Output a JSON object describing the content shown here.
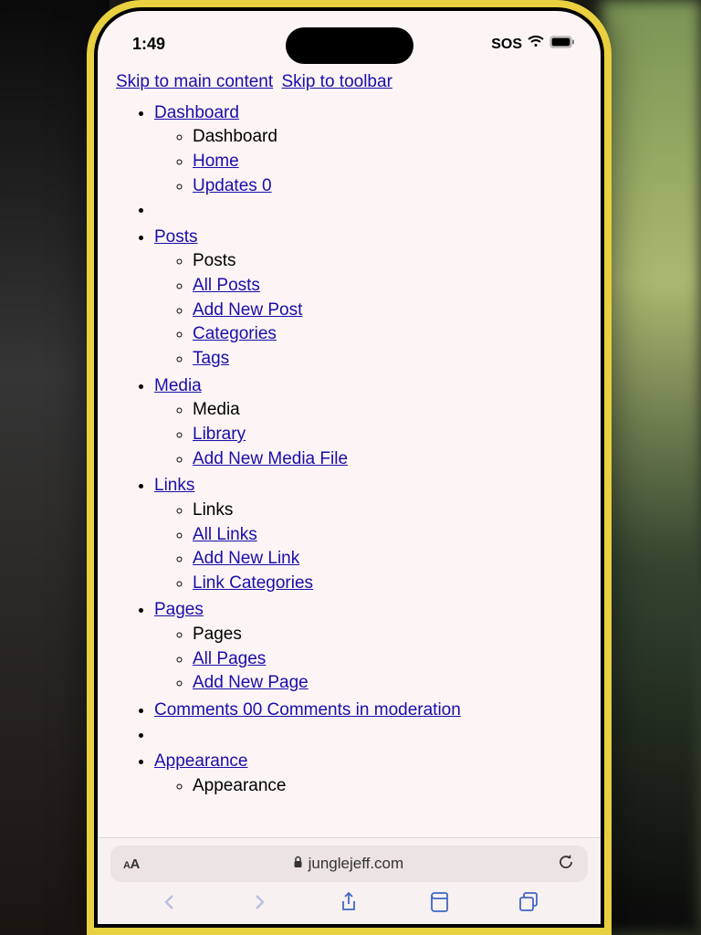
{
  "status": {
    "time": "1:49",
    "sos": "SOS"
  },
  "skip": {
    "main": "Skip to main content",
    "toolbar": "Skip to toolbar"
  },
  "menu": {
    "dashboard": {
      "heading": "Dashboard",
      "items": {
        "dashboard": "Dashboard",
        "home": "Home",
        "updates": "Updates 0"
      }
    },
    "posts": {
      "heading": "Posts",
      "items": {
        "posts": "Posts",
        "all": "All Posts",
        "add": "Add New Post",
        "categories": "Categories",
        "tags": "Tags"
      }
    },
    "media": {
      "heading": "Media",
      "items": {
        "media": "Media",
        "library": "Library",
        "add": "Add New Media File"
      }
    },
    "links": {
      "heading": "Links",
      "items": {
        "links": "Links",
        "all": "All Links",
        "add": "Add New Link",
        "categories": "Link Categories"
      }
    },
    "pages": {
      "heading": "Pages",
      "items": {
        "pages": "Pages",
        "all": "All Pages",
        "add": "Add New Page"
      }
    },
    "comments": {
      "heading": "Comments 00 Comments in moderation"
    },
    "appearance": {
      "heading": "Appearance",
      "items": {
        "appearance": "Appearance"
      }
    }
  },
  "browser": {
    "text_size": "AA",
    "domain": "junglejeff.com"
  }
}
